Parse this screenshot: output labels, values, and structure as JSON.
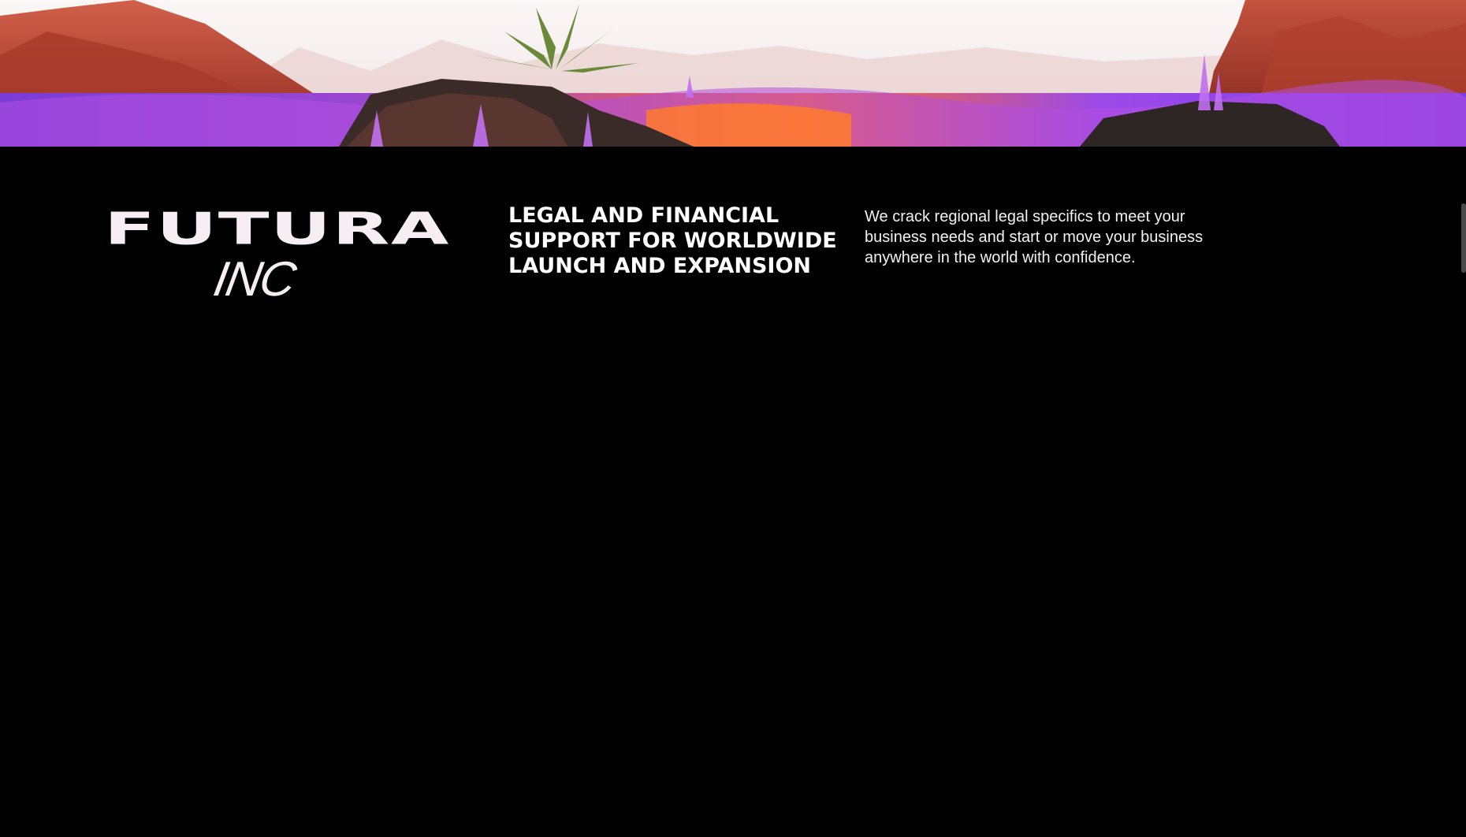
{
  "hero": {
    "image": "alien-landscape-with-purple-grass-and-crystals"
  },
  "brand": {
    "logo_main": "FUTURA",
    "logo_sub": "INC"
  },
  "tagline": {
    "lines": [
      "LEGAL AND FINANCIAL",
      "SUPPORT FOR WORLDWIDE",
      "LAUNCH AND EXPANSION"
    ]
  },
  "description": {
    "text": "We crack regional legal specifics to meet your business needs and start or move your business anywhere in the world with confidence."
  },
  "colors": {
    "background": "#000000",
    "text": "#ffffff",
    "accent_purple": "#8a3cf0",
    "accent_orange": "#ff5a1f"
  }
}
